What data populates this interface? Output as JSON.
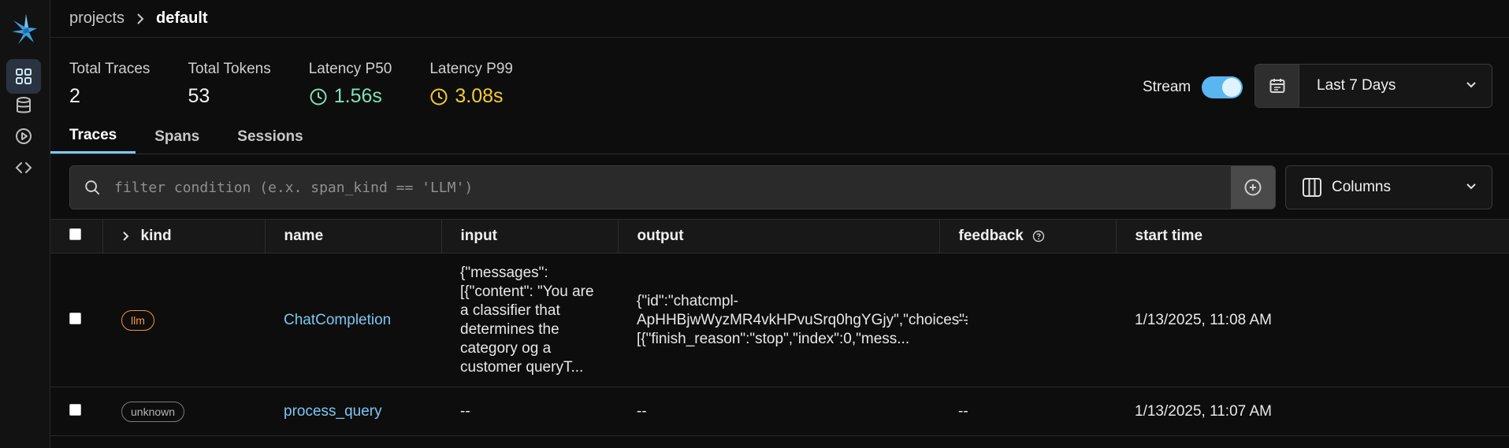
{
  "breadcrumb": {
    "parent": "projects",
    "current": "default"
  },
  "stats": [
    {
      "label": "Total Traces",
      "value": "2",
      "tone": "plain"
    },
    {
      "label": "Total Tokens",
      "value": "53",
      "tone": "plain"
    },
    {
      "label": "Latency P50",
      "value": "1.56s",
      "tone": "green"
    },
    {
      "label": "Latency P99",
      "value": "3.08s",
      "tone": "yellow"
    }
  ],
  "stream": {
    "label": "Stream",
    "enabled": true
  },
  "date_range": {
    "label": "Last 7 Days"
  },
  "tabs": [
    {
      "label": "Traces",
      "active": true
    },
    {
      "label": "Spans",
      "active": false
    },
    {
      "label": "Sessions",
      "active": false
    }
  ],
  "filter": {
    "placeholder": "filter condition (e.x. span_kind == 'LLM')",
    "value": ""
  },
  "columns_button": {
    "label": "Columns"
  },
  "table": {
    "headers": {
      "kind": "kind",
      "name": "name",
      "input": "input",
      "output": "output",
      "feedback": "feedback",
      "start_time": "start time"
    },
    "rows": [
      {
        "kind": "llm",
        "name": "ChatCompletion",
        "input": "{\"messages\": [{\"content\": \"You are a classifier that determines the category og a customer queryT...",
        "output": "{\"id\":\"chatcmpl-ApHHBjwWyzMR4vkHPvuSrq0hgYGjy\",\"choices\":[{\"finish_reason\":\"stop\",\"index\":0,\"mess...",
        "feedback": "--",
        "start_time": "1/13/2025, 11:08 AM"
      },
      {
        "kind": "unknown",
        "name": "process_query",
        "input": "--",
        "output": "--",
        "feedback": "--",
        "start_time": "1/13/2025, 11:07 AM"
      }
    ]
  },
  "colors": {
    "accent": "#7cc7f2",
    "llm_badge": "#f0963b",
    "latency_p50": "#7ee2b8",
    "latency_p99": "#f5cd2e",
    "toggle_on": "#5ab6f0"
  },
  "icons": {
    "sidebar": [
      "bird-logo-icon",
      "grid-icon",
      "database-icon",
      "play-circle-icon",
      "code-icon"
    ],
    "filter": [
      "search-icon",
      "plus-circle-icon"
    ],
    "date": "calendar-icon",
    "columns": "columns-icon"
  }
}
